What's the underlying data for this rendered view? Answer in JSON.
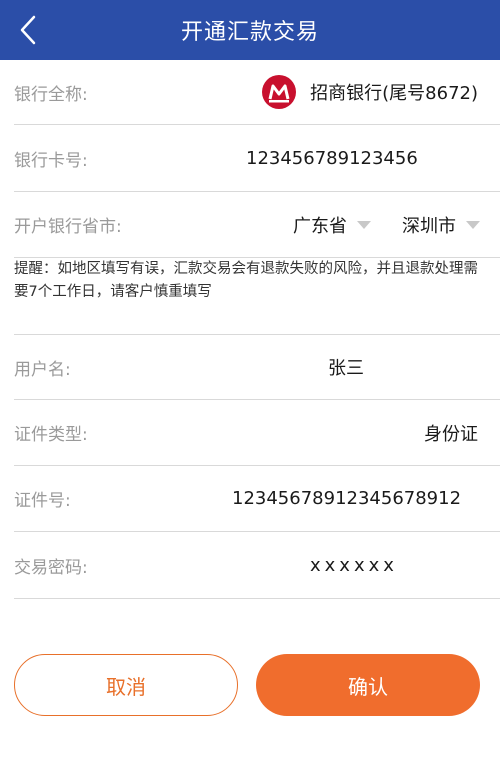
{
  "header": {
    "title": "开通汇款交易",
    "back_icon": "chevron-left-icon"
  },
  "bank_name": {
    "label": "银行全称:",
    "value": "招商银行(尾号8672)",
    "logo_icon": "cmb-logo-icon",
    "logo_color": "#c8102e"
  },
  "card_number": {
    "label": "银行卡号:",
    "value": "123456789123456"
  },
  "region": {
    "label": "开户银行省市:",
    "province": "广东省",
    "city": "深圳市"
  },
  "notice": "提醒：如地区填写有误，汇款交易会有退款失败的风险，并且退款处理需要7个工作日，请客户慎重填写",
  "username": {
    "label": "用户名:",
    "value": "张三"
  },
  "id_type": {
    "label": "证件类型:",
    "value": "身份证"
  },
  "id_number": {
    "label": "证件号:",
    "value": "1234567891234567891​2"
  },
  "password": {
    "label": "交易密码:",
    "value": "xxxxxx"
  },
  "buttons": {
    "cancel": "取消",
    "confirm": "确认"
  },
  "colors": {
    "header": "#2b4ea8",
    "accent": "#f06d2d"
  }
}
